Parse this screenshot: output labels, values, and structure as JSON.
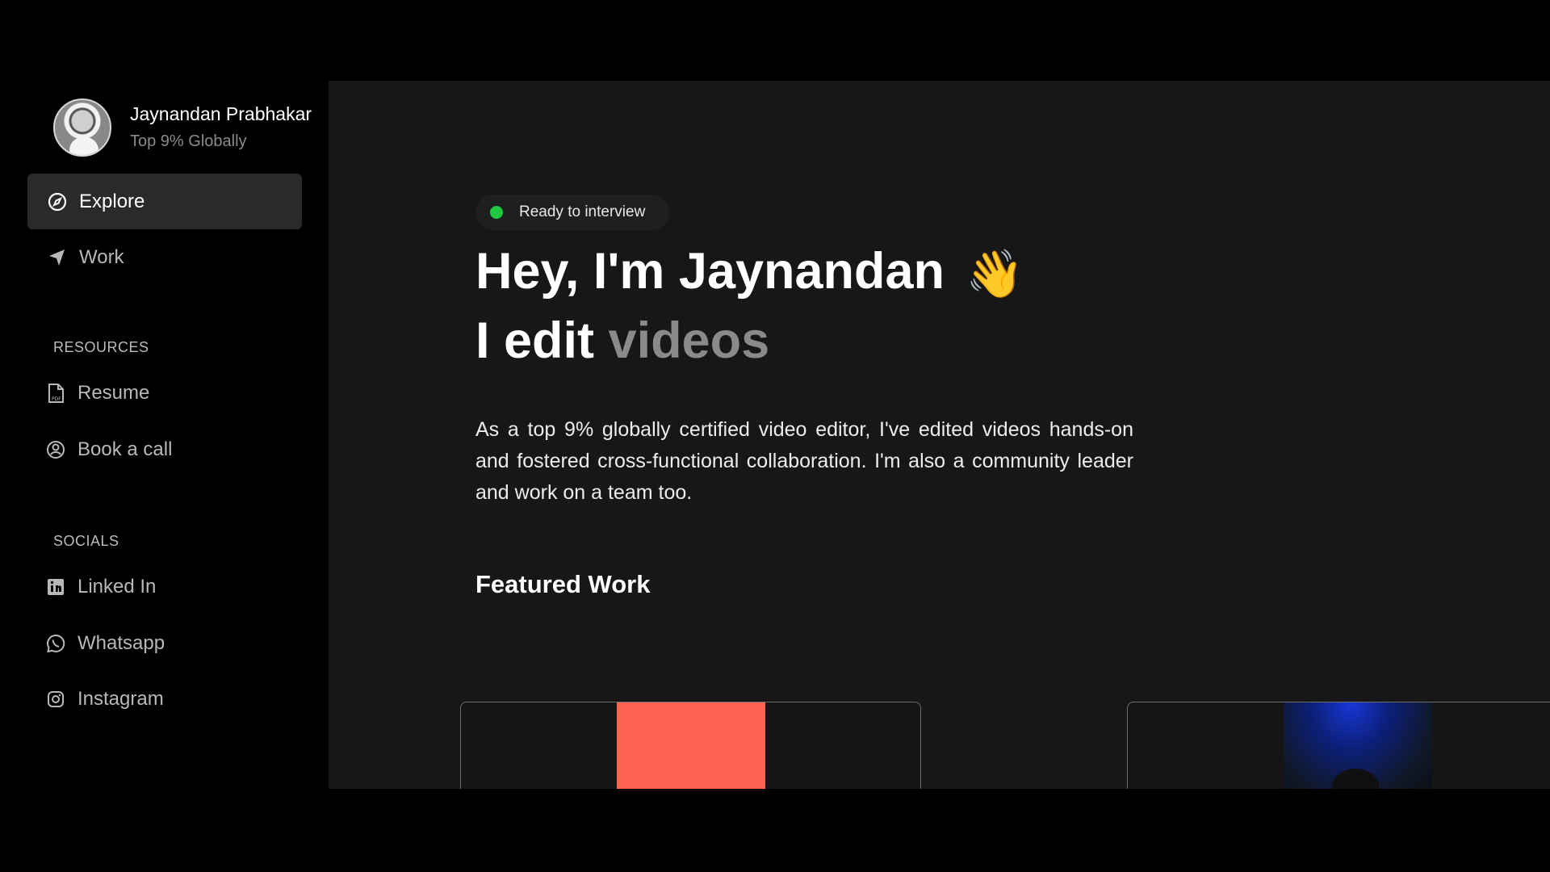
{
  "profile": {
    "name": "Jaynandan Prabhakar",
    "subtitle": "Top 9% Globally"
  },
  "nav": {
    "explore": "Explore",
    "work": "Work"
  },
  "resources": {
    "title": "RESOURCES",
    "resume": "Resume",
    "book_call": "Book a call"
  },
  "socials": {
    "title": "SOCIALS",
    "linkedin": "Linked In",
    "whatsapp": "Whatsapp",
    "instagram": "Instagram"
  },
  "hero": {
    "status": "Ready to interview",
    "greeting": "Hey, I'm Jaynandan",
    "emoji": "👋",
    "edit_prefix": "I edit",
    "edit_word": "videos",
    "bio": "As a top 9% globally certified video editor, I've edited videos hands-on and fostered cross-functional collaboration. I'm also a community leader and work on a team too.",
    "featured_title": "Featured Work"
  },
  "colors": {
    "main_bg": "#171717",
    "sidebar_bg": "#000000",
    "active_nav": "#2a2a2a",
    "status_green": "#21c941",
    "card_orange": "#ff6352"
  },
  "icons": {
    "explore": "compass-icon",
    "work": "send-arrow-icon",
    "resume": "pdf-file-icon",
    "book_call": "user-circle-icon",
    "linkedin": "linkedin-icon",
    "whatsapp": "whatsapp-icon",
    "instagram": "instagram-icon"
  }
}
